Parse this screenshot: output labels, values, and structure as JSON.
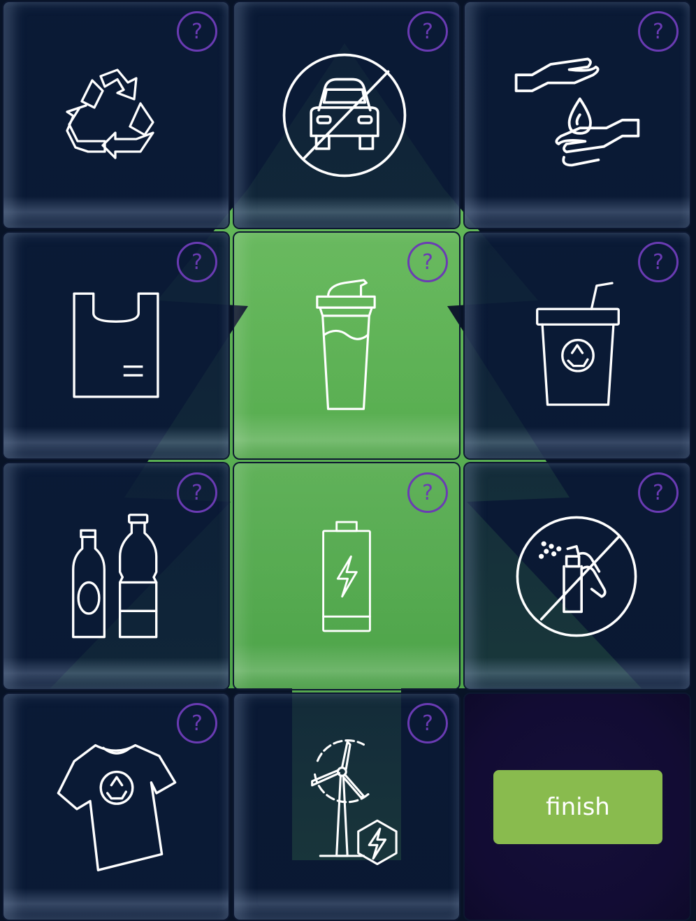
{
  "colors": {
    "background": "#081326",
    "tile": "#0a1a36",
    "tree": "#5fb356",
    "question_ring": "#6a3bb3",
    "icon_stroke": "#ffffff",
    "finish_button": "#89bb4e"
  },
  "question_mark": "?",
  "tiles": [
    {
      "icon": "recycle-icon",
      "state": "hidden"
    },
    {
      "icon": "no-car-icon",
      "state": "hidden"
    },
    {
      "icon": "hands-water-drop-icon",
      "state": "hidden"
    },
    {
      "icon": "plastic-bag-icon",
      "state": "hidden"
    },
    {
      "icon": "shaker-bottle-icon",
      "state": "revealed"
    },
    {
      "icon": "recyclable-cup-icon",
      "state": "hidden"
    },
    {
      "icon": "bottles-icon",
      "state": "hidden"
    },
    {
      "icon": "battery-icon",
      "state": "revealed"
    },
    {
      "icon": "no-aerosol-spray-icon",
      "state": "hidden"
    },
    {
      "icon": "recycled-tshirt-icon",
      "state": "hidden"
    },
    {
      "icon": "wind-turbine-energy-icon",
      "state": "hidden"
    }
  ],
  "finish_label": "finish"
}
